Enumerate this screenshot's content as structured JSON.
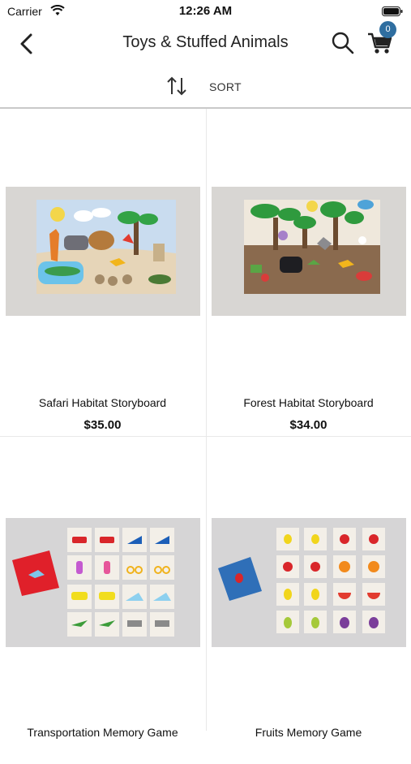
{
  "status": {
    "carrier": "Carrier",
    "time": "12:26 AM"
  },
  "nav": {
    "title": "Toys & Stuffed Animals",
    "cart_count": "0"
  },
  "sort": {
    "label": "SORT"
  },
  "products": [
    {
      "name": "Safari Habitat Storyboard",
      "price": "$35.00"
    },
    {
      "name": "Forest Habitat Storyboard",
      "price": "$34.00"
    },
    {
      "name": "Transportation Memory Game",
      "price": ""
    },
    {
      "name": "Fruits Memory Game",
      "price": ""
    }
  ],
  "colors": {
    "accent": "#2f6ea0",
    "divider": "#c9c9c9"
  }
}
